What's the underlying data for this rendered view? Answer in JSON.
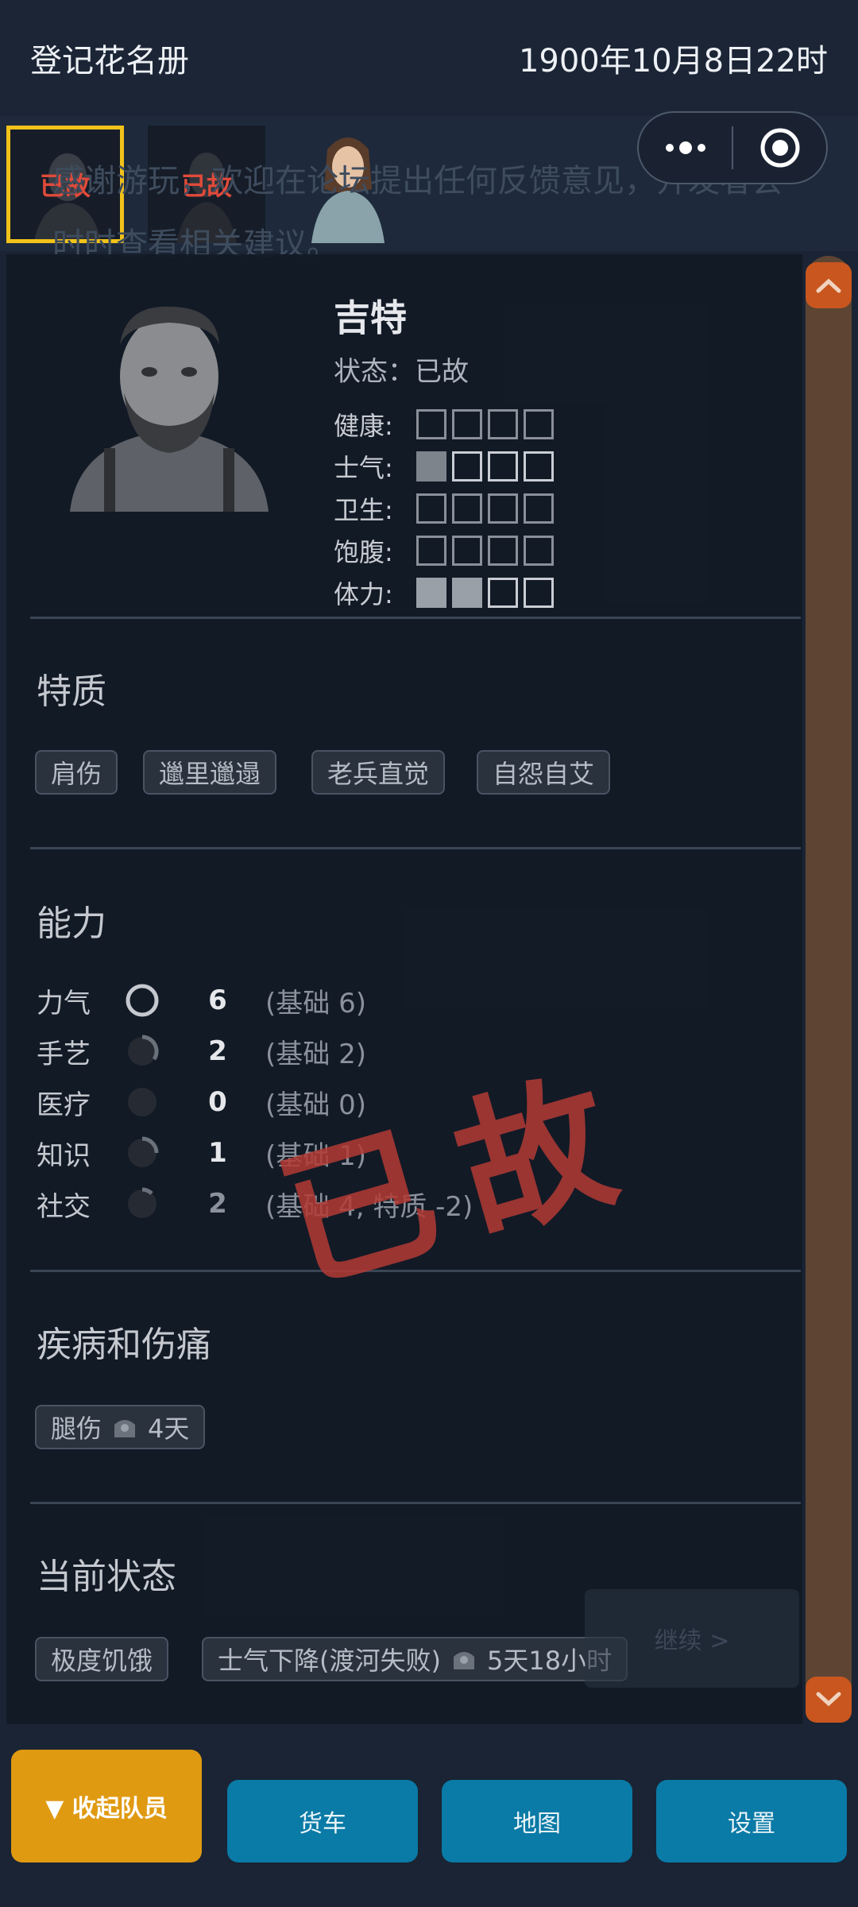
{
  "header": {
    "title": "登记花名册",
    "datetime": "1900年10月8日22时"
  },
  "roster": [
    {
      "status": "已故",
      "selected": true
    },
    {
      "status": "已故",
      "selected": false
    },
    {
      "status": "",
      "selected": false
    }
  ],
  "background_text": "感谢游玩，欢迎在论坛提出任何反馈意见，开发者会时时查看相关建议。",
  "character": {
    "name": "吉特",
    "status_label": "状态：已故",
    "stats": [
      {
        "label": "健康:",
        "filled": 0
      },
      {
        "label": "士气:",
        "filled": 1
      },
      {
        "label": "卫生:",
        "filled": 0
      },
      {
        "label": "饱腹:",
        "filled": 0
      },
      {
        "label": "体力:",
        "filled": 2
      }
    ]
  },
  "stamp": "已故",
  "traits": {
    "title": "特质",
    "items": [
      "肩伤",
      "邋里邋遢",
      "老兵直觉",
      "自怨自艾"
    ]
  },
  "abilities": {
    "title": "能力",
    "items": [
      {
        "name": "力气",
        "value": "6",
        "base": "(基础 6)"
      },
      {
        "name": "手艺",
        "value": "2",
        "base": "(基础 2)"
      },
      {
        "name": "医疗",
        "value": "0",
        "base": "(基础 0)"
      },
      {
        "name": "知识",
        "value": "1",
        "base": "(基础 1)"
      },
      {
        "name": "社交",
        "value": "2",
        "base": "(基础 4, 特质 -2)"
      }
    ]
  },
  "injuries": {
    "title": "疾病和伤痛",
    "items": [
      {
        "name": "腿伤",
        "duration": "4天"
      }
    ]
  },
  "current_status": {
    "title": "当前状态",
    "items": [
      {
        "name": "极度饥饿"
      },
      {
        "name": "士气下降(渡河失败)",
        "duration": "5天18小时"
      }
    ]
  },
  "ghost_button": "继续 >",
  "bottom_bar": {
    "collapse": "▼ 收起队员",
    "truck": "货车",
    "map": "地图",
    "settings": "设置"
  },
  "colors": {
    "accent": "#e09a12",
    "nav": "#0a7aa6",
    "dead": "#e04a3a",
    "scroll": "#c8561e"
  }
}
